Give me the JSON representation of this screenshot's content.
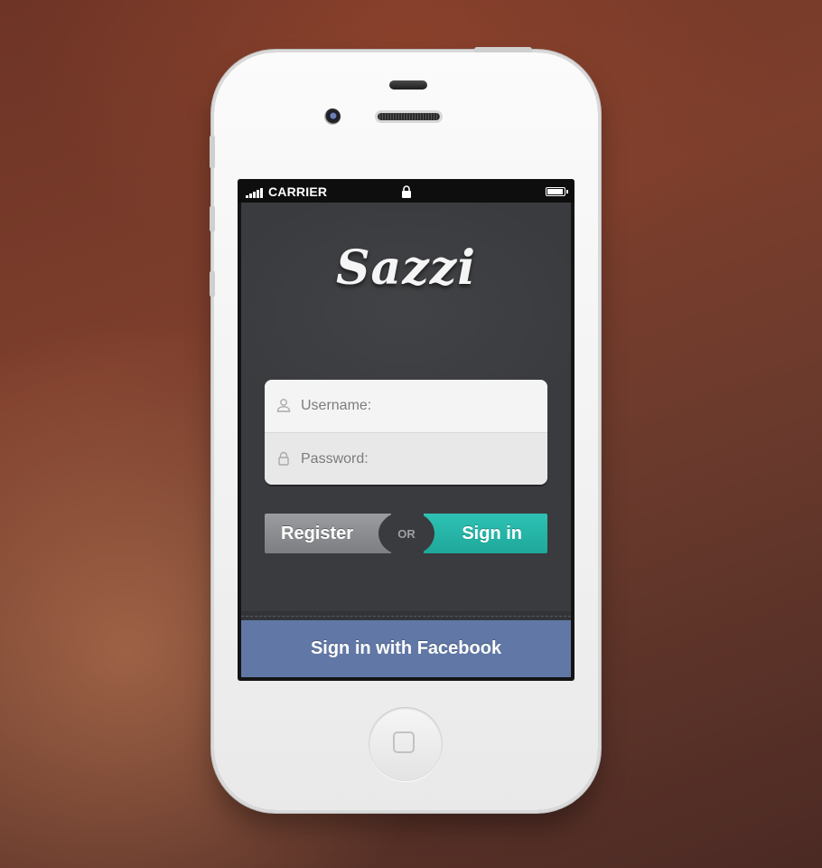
{
  "status_bar": {
    "carrier": "CARRIER",
    "signal_icon": "signal-bars-icon",
    "lock_icon": "lock-icon",
    "battery_icon": "battery-icon"
  },
  "app": {
    "logo": "Sazzi",
    "username_placeholder": "Username:",
    "password_placeholder": "Password:",
    "username_icon": "user-icon",
    "password_icon": "lock-icon",
    "register_label": "Register",
    "or_label": "OR",
    "signin_label": "Sign in",
    "facebook_label": "Sign in with Facebook"
  },
  "colors": {
    "signin_accent": "#25b5a8",
    "facebook_blue": "#6178a6",
    "register_gray": "#8b8d90",
    "app_background": "#3a3b3e"
  }
}
